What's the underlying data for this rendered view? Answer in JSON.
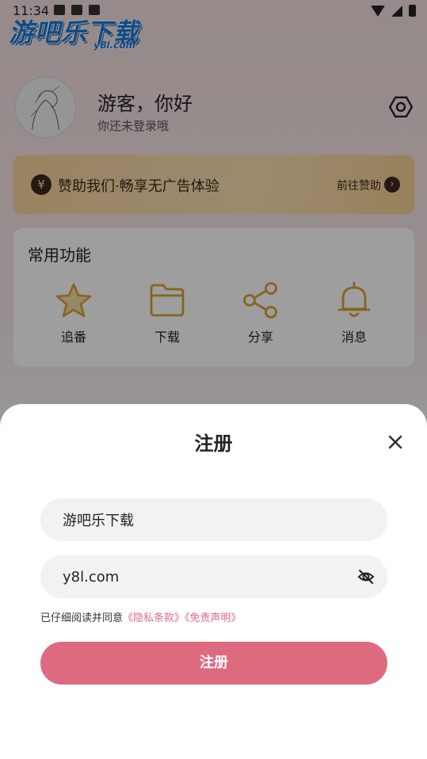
{
  "status_bar": {
    "time": "11:34"
  },
  "watermark": {
    "main": "游吧乐下载",
    "sub": "y8l.com"
  },
  "profile": {
    "greeting": "游客，你好",
    "subtitle": "你还未登录哦"
  },
  "sponsor": {
    "icon_symbol": "¥",
    "text": "赞助我们·畅享无广告体验",
    "link": "前往赞助",
    "arrow": "›"
  },
  "functions": {
    "title": "常用功能",
    "items": [
      {
        "label": "追番",
        "icon": "star-icon"
      },
      {
        "label": "下载",
        "icon": "folder-icon"
      },
      {
        "label": "分享",
        "icon": "share-icon"
      },
      {
        "label": "消息",
        "icon": "bell-icon"
      }
    ]
  },
  "dialog": {
    "title": "注册",
    "username_value": "游吧乐下载",
    "password_value": "y8l.com",
    "agree_prefix": "已仔细阅读并同意",
    "privacy_link": "《隐私条款》",
    "disclaimer_link": "《免责声明》",
    "submit_label": "注册"
  },
  "colors": {
    "accent": "#de6a80",
    "icon_gold": "#d9a235",
    "sponsor_bg": "#f7d39c"
  }
}
